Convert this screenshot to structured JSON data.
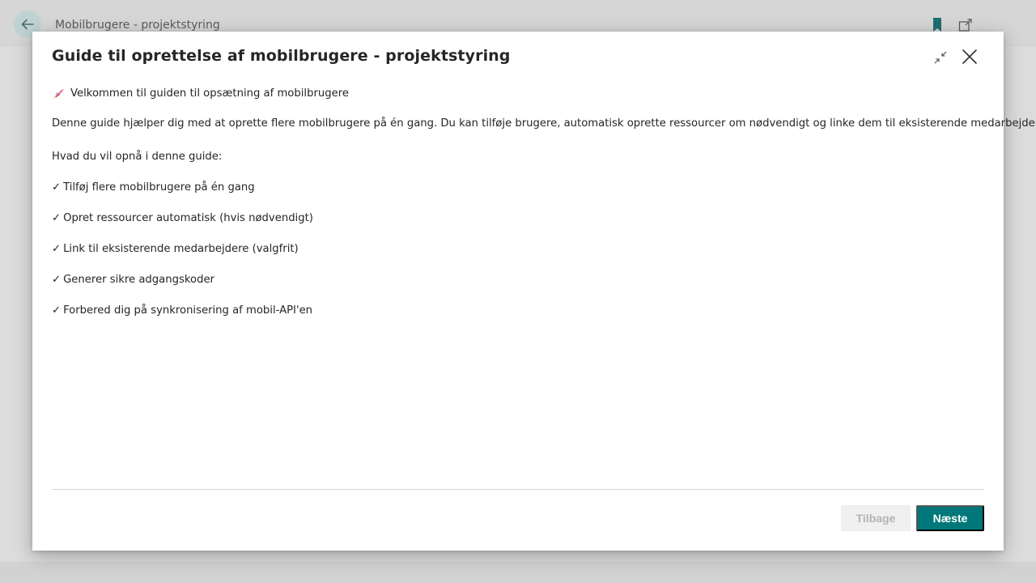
{
  "background": {
    "page_title": "Mobilbrugere - projektstyring",
    "accent_color": "#00787a"
  },
  "dialog": {
    "title": "Guide til oprettelse af mobilbrugere - projektstyring",
    "welcome_icon": "rocket-icon",
    "welcome_text": "Velkommen til guiden til opsætning af mobilbrugere",
    "description": "Denne guide hjælper dig med at oprette flere mobilbrugere på én gang. Du kan tilføje brugere, automatisk oprette ressourcer om nødvendigt og linke dem til eksisterende medarbejdere.",
    "goals_heading": "Hvad du vil opnå i denne guide:",
    "check_symbol": "✓",
    "goals": [
      "Tilføj flere mobilbrugere på én gang",
      "Opret ressourcer automatisk (hvis nødvendigt)",
      "Link til eksisterende medarbejdere (valgfrit)",
      "Generer sikre adgangskoder",
      "Forbered dig på synkronisering af mobil-API'en"
    ],
    "buttons": {
      "back_label": "Tilbage",
      "next_label": "Næste"
    }
  }
}
